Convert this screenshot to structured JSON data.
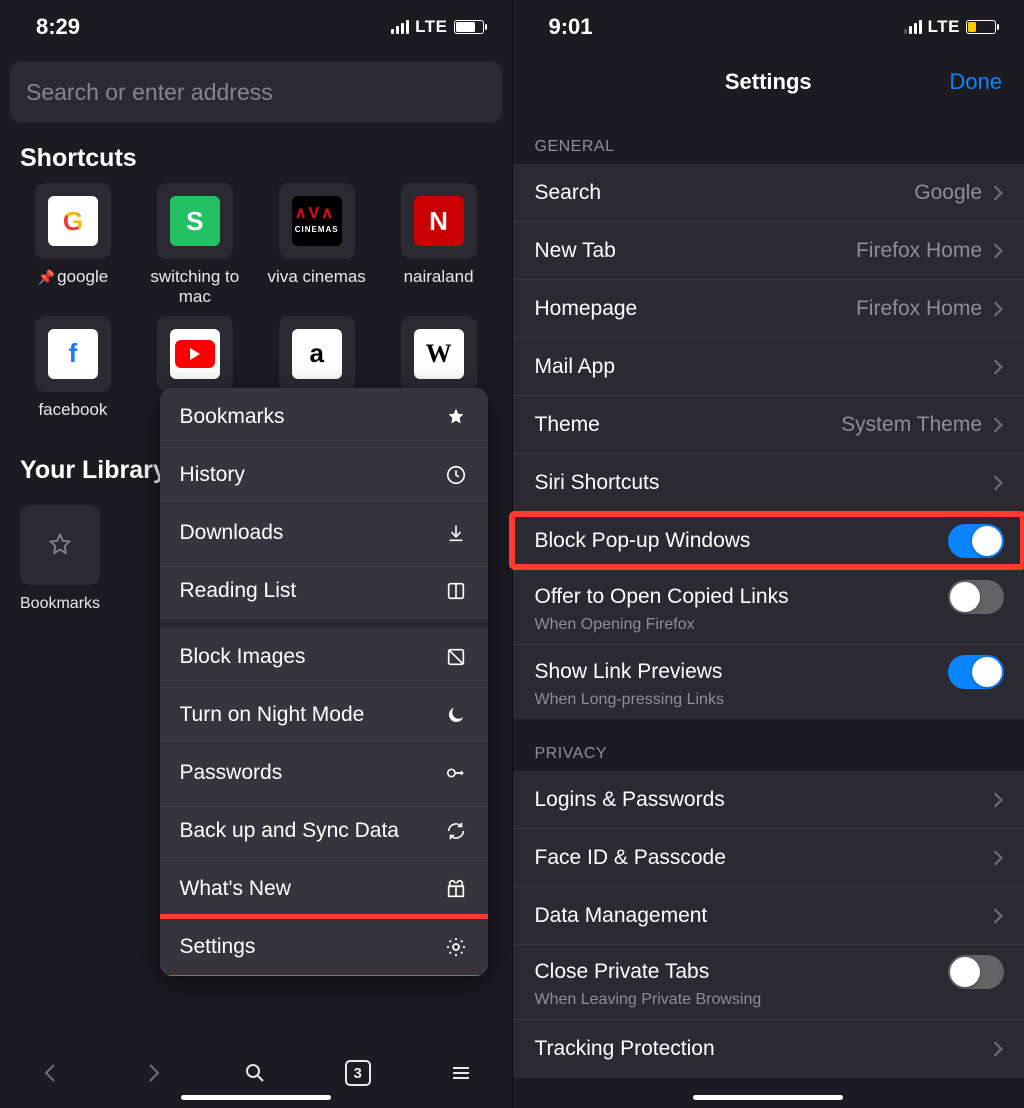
{
  "left": {
    "status": {
      "time": "8:29",
      "net": "LTE"
    },
    "search": {
      "placeholder": "Search or enter address"
    },
    "shortcuts_label": "Shortcuts",
    "shortcuts": [
      {
        "label": "google",
        "glyph": "G",
        "tile": "tile-g",
        "pinned": true
      },
      {
        "label": "switching to mac",
        "glyph": "S",
        "tile": "tile-s",
        "pinned": false
      },
      {
        "label": "viva cinemas",
        "glyph": "▞▚",
        "tile": "tile-v",
        "pinned": false
      },
      {
        "label": "nairaland",
        "glyph": "N",
        "tile": "tile-n",
        "pinned": false
      },
      {
        "label": "facebook",
        "glyph": "f",
        "tile": "tile-fb",
        "pinned": false
      },
      {
        "label": "",
        "glyph": "▶",
        "tile": "tile-yt",
        "pinned": false
      },
      {
        "label": "",
        "glyph": "a",
        "tile": "tile-am",
        "pinned": false
      },
      {
        "label": "",
        "glyph": "W",
        "tile": "tile-w",
        "pinned": false
      }
    ],
    "library_label": "Your Library",
    "library": [
      {
        "label": "Bookmarks"
      }
    ],
    "menu": [
      {
        "label": "Bookmarks",
        "icon": "star-icon",
        "kind": "item"
      },
      {
        "label": "History",
        "icon": "clock-icon",
        "kind": "item"
      },
      {
        "label": "Downloads",
        "icon": "download-icon",
        "kind": "item"
      },
      {
        "label": "Reading List",
        "icon": "book-icon",
        "kind": "item"
      },
      {
        "kind": "sep"
      },
      {
        "label": "Block Images",
        "icon": "no-image-icon",
        "kind": "item"
      },
      {
        "label": "Turn on Night Mode",
        "icon": "moon-icon",
        "kind": "item"
      },
      {
        "label": "Passwords",
        "icon": "key-icon",
        "kind": "item"
      },
      {
        "label": "Back up and Sync Data",
        "icon": "sync-icon",
        "kind": "item"
      },
      {
        "label": "What's New",
        "icon": "gift-icon",
        "kind": "item"
      },
      {
        "label": "Settings",
        "icon": "gear-icon",
        "kind": "item",
        "highlight": true
      }
    ],
    "tab_count": "3"
  },
  "right": {
    "status": {
      "time": "9:01",
      "net": "LTE"
    },
    "title": "Settings",
    "done": "Done",
    "groups": [
      {
        "header": "GENERAL",
        "rows": [
          {
            "label": "Search",
            "value": "Google",
            "type": "link"
          },
          {
            "label": "New Tab",
            "value": "Firefox Home",
            "type": "link"
          },
          {
            "label": "Homepage",
            "value": "Firefox Home",
            "type": "link"
          },
          {
            "label": "Mail App",
            "value": "",
            "type": "link"
          },
          {
            "label": "Theme",
            "value": "System Theme",
            "type": "link"
          },
          {
            "label": "Siri Shortcuts",
            "value": "",
            "type": "link"
          },
          {
            "label": "Block Pop-up Windows",
            "value": "",
            "type": "toggle",
            "on": true,
            "highlight": true
          },
          {
            "label": "Offer to Open Copied Links",
            "sub": "When Opening Firefox",
            "type": "toggle",
            "on": false
          },
          {
            "label": "Show Link Previews",
            "sub": "When Long-pressing Links",
            "type": "toggle",
            "on": true
          }
        ]
      },
      {
        "header": "PRIVACY",
        "rows": [
          {
            "label": "Logins & Passwords",
            "type": "link"
          },
          {
            "label": "Face ID & Passcode",
            "type": "link"
          },
          {
            "label": "Data Management",
            "type": "link"
          },
          {
            "label": "Close Private Tabs",
            "sub": "When Leaving Private Browsing",
            "type": "toggle",
            "on": false
          },
          {
            "label": "Tracking Protection",
            "type": "link"
          }
        ]
      }
    ]
  }
}
